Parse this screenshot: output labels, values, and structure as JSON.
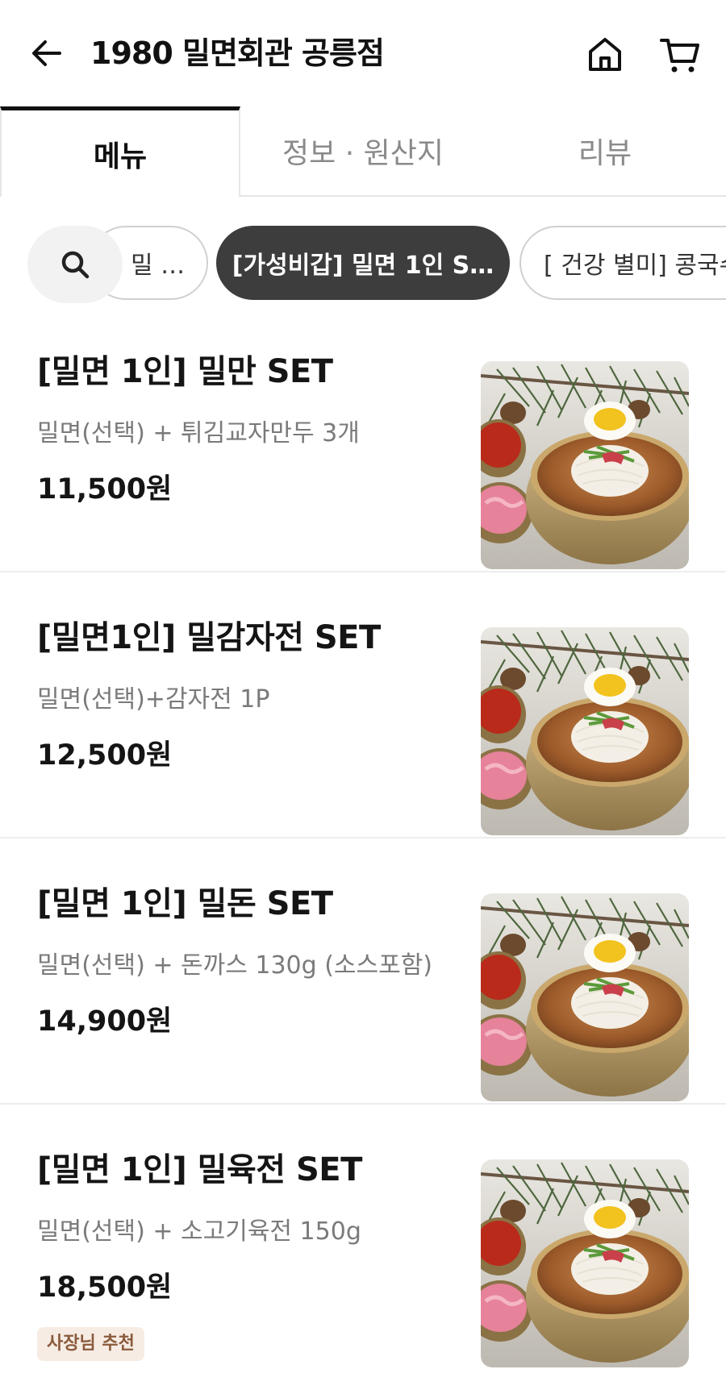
{
  "header": {
    "title": "1980 밀면회관 공릉점",
    "back_icon": "arrow-left-icon",
    "home_icon": "home-icon",
    "cart_icon": "cart-icon"
  },
  "tabs": [
    {
      "label": "메뉴",
      "active": true
    },
    {
      "label": "정보 · 원산지",
      "active": false
    },
    {
      "label": "리뷰",
      "active": false
    }
  ],
  "category_chips": {
    "search_icon": "search-icon",
    "items": [
      {
        "label": "밀  …",
        "selected": false
      },
      {
        "label": "[가성비갑] 밀면 1인 S…",
        "selected": true
      },
      {
        "label": "[ 건강 별미] 콩국수",
        "selected": false
      }
    ]
  },
  "menu_items": [
    {
      "name": "[밀면 1인]  밀만 SET",
      "description": "밀면(선택) + 튀김교자만두 3개",
      "price": "11,500원",
      "badge": ""
    },
    {
      "name": "[밀면1인] 밀감자전 SET",
      "description": "밀면(선택)+감자전 1P",
      "price": "12,500원",
      "badge": ""
    },
    {
      "name": "[밀면 1인] 밀돈 SET",
      "description": "밀면(선택) + 돈까스 130g (소스포함)",
      "price": "14,900원",
      "badge": ""
    },
    {
      "name": "[밀면 1인] 밀육전 SET",
      "description": "밀면(선택) + 소고기육전 150g",
      "price": "18,500원",
      "badge": "사장님 추천"
    }
  ],
  "colors": {
    "selected_chip_bg": "#3d3d3d",
    "badge_bg": "#f6ece4",
    "badge_text": "#8b5a3c"
  }
}
